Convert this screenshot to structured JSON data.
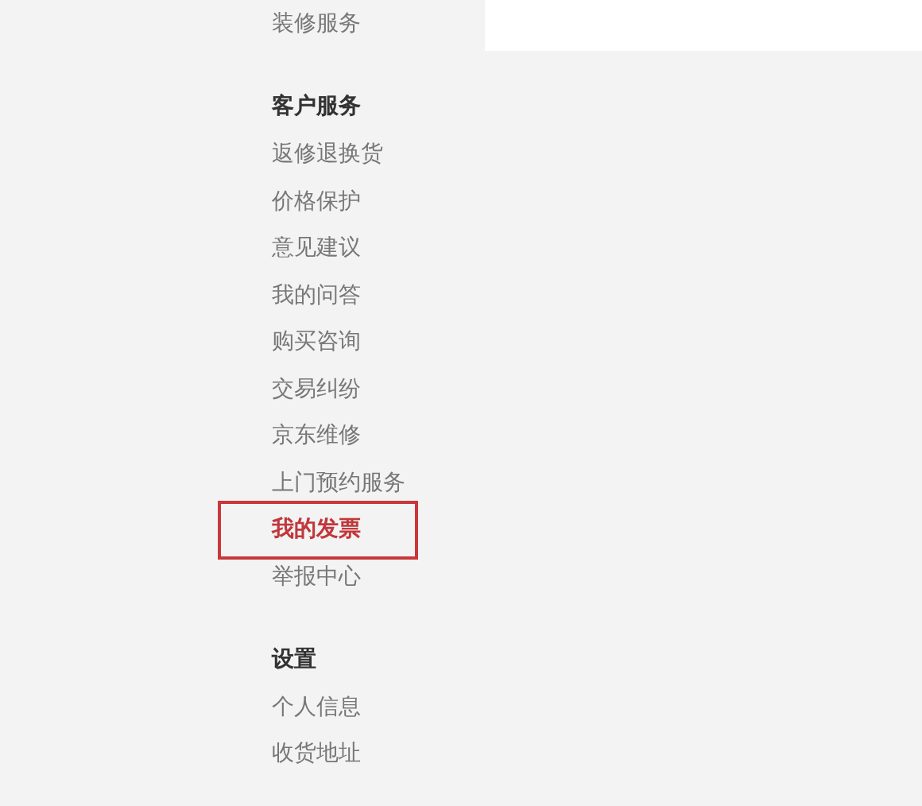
{
  "sidebar": {
    "sections": [
      {
        "items": [
          {
            "label": "装修服务",
            "selected": false
          }
        ]
      },
      {
        "heading": "客户服务",
        "items": [
          {
            "label": "返修退换货",
            "selected": false
          },
          {
            "label": "价格保护",
            "selected": false
          },
          {
            "label": "意见建议",
            "selected": false
          },
          {
            "label": "我的问答",
            "selected": false
          },
          {
            "label": "购买咨询",
            "selected": false
          },
          {
            "label": "交易纠纷",
            "selected": false
          },
          {
            "label": "京东维修",
            "selected": false
          },
          {
            "label": "上门预约服务",
            "selected": false
          },
          {
            "label": "我的发票",
            "selected": true
          },
          {
            "label": "举报中心",
            "selected": false
          }
        ]
      },
      {
        "heading": "设置",
        "items": [
          {
            "label": "个人信息",
            "selected": false
          },
          {
            "label": "收货地址",
            "selected": false
          }
        ]
      }
    ]
  }
}
